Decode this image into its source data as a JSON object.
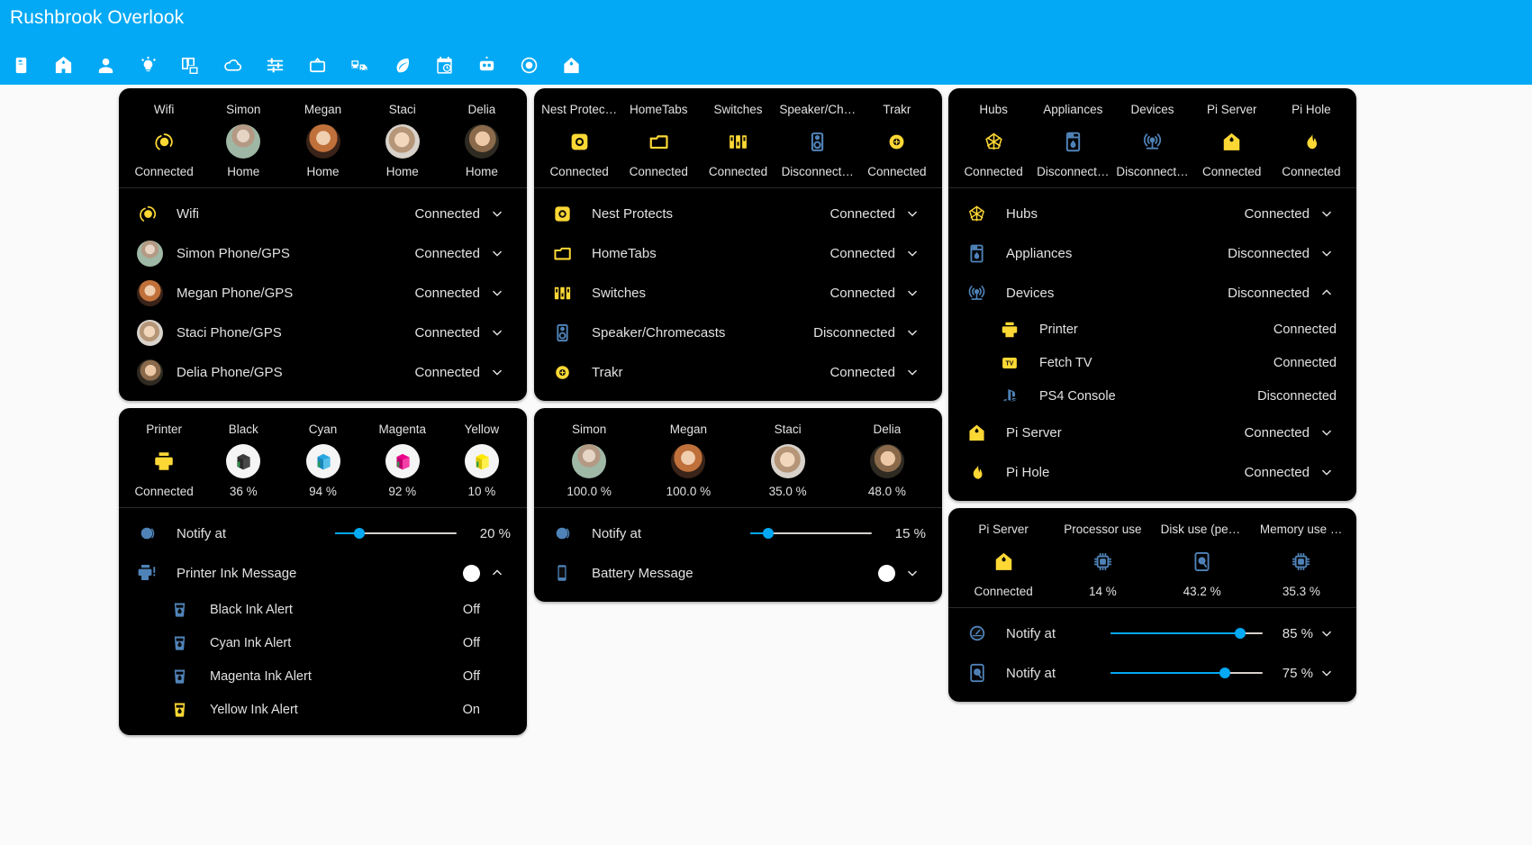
{
  "header": {
    "title": "Rushbrook Overlook",
    "accent": "#03a9f4",
    "tabs": [
      {
        "name": "tab-notebook",
        "icon": "notebook-icon"
      },
      {
        "name": "tab-home-tree",
        "icon": "home-tree-icon"
      },
      {
        "name": "tab-person",
        "icon": "person-icon"
      },
      {
        "name": "tab-lights",
        "icon": "lightbulb-icon"
      },
      {
        "name": "tab-devices",
        "icon": "devices-star-icon",
        "active": true
      },
      {
        "name": "tab-weather",
        "icon": "cloud-icon"
      },
      {
        "name": "tab-settings",
        "icon": "sliders-icon"
      },
      {
        "name": "tab-media",
        "icon": "television-icon"
      },
      {
        "name": "tab-transit",
        "icon": "bus-car-icon"
      },
      {
        "name": "tab-energy",
        "icon": "leaf-icon"
      },
      {
        "name": "tab-calendar",
        "icon": "calendar-clock-icon"
      },
      {
        "name": "tab-automation",
        "icon": "robot-icon"
      },
      {
        "name": "tab-cameras",
        "icon": "eye-icon"
      },
      {
        "name": "tab-house",
        "icon": "home-icon"
      }
    ]
  },
  "cards": {
    "network": {
      "glance": [
        {
          "name": "Wifi",
          "state": "Connected",
          "icon": "wifi-target-icon",
          "color": "#fdd835"
        },
        {
          "name": "Simon",
          "state": "Home",
          "icon": "avatar",
          "avatar": "simon"
        },
        {
          "name": "Megan",
          "state": "Home",
          "icon": "avatar",
          "avatar": "megan"
        },
        {
          "name": "Staci",
          "state": "Home",
          "icon": "avatar",
          "avatar": "staci"
        },
        {
          "name": "Delia",
          "state": "Home",
          "icon": "avatar",
          "avatar": "delia"
        }
      ],
      "rows": [
        {
          "label": "Wifi",
          "state": "Connected",
          "icon": "wifi-target-icon",
          "color": "#fdd835",
          "chevron": "down"
        },
        {
          "label": "Simon Phone/GPS",
          "state": "Connected",
          "icon": "avatar",
          "avatar": "simon",
          "chevron": "down"
        },
        {
          "label": "Megan Phone/GPS",
          "state": "Connected",
          "icon": "avatar",
          "avatar": "megan",
          "chevron": "down"
        },
        {
          "label": "Staci Phone/GPS",
          "state": "Connected",
          "icon": "avatar",
          "avatar": "staci",
          "chevron": "down"
        },
        {
          "label": "Delia Phone/GPS",
          "state": "Connected",
          "icon": "avatar",
          "avatar": "delia",
          "chevron": "down"
        }
      ]
    },
    "printer": {
      "glance": [
        {
          "name": "Printer",
          "state": "Connected",
          "icon": "printer-icon",
          "color": "#fdd835"
        },
        {
          "name": "Black",
          "state": "36 %",
          "icon": "ink-cartridge",
          "inkcolor": "#3c3c3c"
        },
        {
          "name": "Cyan",
          "state": "94 %",
          "icon": "ink-cartridge",
          "inkcolor": "#28a8e0"
        },
        {
          "name": "Magenta",
          "state": "92 %",
          "icon": "ink-cartridge",
          "inkcolor": "#ec008c"
        },
        {
          "name": "Yellow",
          "state": "10 %",
          "icon": "ink-cartridge",
          "inkcolor": "#ffe800"
        }
      ],
      "notify": {
        "label": "Notify at",
        "value": "20 %",
        "percent": 20,
        "icon": "bell-circle-icon"
      },
      "message": {
        "label": "Printer Ink Message",
        "icon": "printer-alert-icon",
        "toggle": "on",
        "chevron": "up"
      },
      "alerts": [
        {
          "label": "Black Ink Alert",
          "state": "Off",
          "icon": "ink-cup-icon",
          "color": "#4f83b8"
        },
        {
          "label": "Cyan Ink Alert",
          "state": "Off",
          "icon": "ink-cup-icon",
          "color": "#4f83b8"
        },
        {
          "label": "Magenta Ink Alert",
          "state": "Off",
          "icon": "ink-cup-icon",
          "color": "#4f83b8"
        },
        {
          "label": "Yellow Ink Alert",
          "state": "On",
          "icon": "ink-cup-icon",
          "color": "#fdd835"
        }
      ]
    },
    "nest": {
      "glance": [
        {
          "name": "Nest Protec…",
          "state": "Connected",
          "icon": "nest-protect-icon",
          "color": "#fdd835"
        },
        {
          "name": "HomeTabs",
          "state": "Connected",
          "icon": "tablet-folder-icon",
          "color": "#fdd835"
        },
        {
          "name": "Switches",
          "state": "Connected",
          "icon": "switches-icon",
          "color": "#fdd835"
        },
        {
          "name": "Speaker/Ch…",
          "state": "Disconnect…",
          "icon": "speaker-icon",
          "color": "#4f83b8"
        },
        {
          "name": "Trakr",
          "state": "Connected",
          "icon": "trakr-icon",
          "color": "#fdd835"
        }
      ],
      "rows": [
        {
          "label": "Nest Protects",
          "state": "Connected",
          "icon": "nest-protect-icon",
          "color": "#fdd835",
          "chevron": "down"
        },
        {
          "label": "HomeTabs",
          "state": "Connected",
          "icon": "tablet-folder-icon",
          "color": "#fdd835",
          "chevron": "down"
        },
        {
          "label": "Switches",
          "state": "Connected",
          "icon": "switches-icon",
          "color": "#fdd835",
          "chevron": "down"
        },
        {
          "label": "Speaker/Chromecasts",
          "state": "Disconnected",
          "icon": "speaker-icon",
          "color": "#4f83b8",
          "chevron": "down"
        },
        {
          "label": "Trakr",
          "state": "Connected",
          "icon": "trakr-icon",
          "color": "#fdd835",
          "chevron": "down"
        }
      ]
    },
    "battery": {
      "glance": [
        {
          "name": "Simon",
          "state": "100.0 %",
          "icon": "avatar",
          "avatar": "simon"
        },
        {
          "name": "Megan",
          "state": "100.0 %",
          "icon": "avatar",
          "avatar": "megan"
        },
        {
          "name": "Staci",
          "state": "35.0 %",
          "icon": "avatar",
          "avatar": "staci"
        },
        {
          "name": "Delia",
          "state": "48.0 %",
          "icon": "avatar",
          "avatar": "delia"
        }
      ],
      "notify": {
        "label": "Notify at",
        "value": "15 %",
        "percent": 15,
        "icon": "bell-circle-icon"
      },
      "message": {
        "label": "Battery Message",
        "icon": "phone-icon",
        "toggle": "on",
        "chevron": "down"
      }
    },
    "hubs": {
      "glance": [
        {
          "name": "Hubs",
          "state": "Connected",
          "icon": "hub-icon",
          "color": "#fdd835"
        },
        {
          "name": "Appliances",
          "state": "Disconnect…",
          "icon": "washer-icon",
          "color": "#4f83b8"
        },
        {
          "name": "Devices",
          "state": "Disconnect…",
          "icon": "broadcast-icon",
          "color": "#4f83b8"
        },
        {
          "name": "Pi Server",
          "state": "Connected",
          "icon": "home-tree-icon",
          "color": "#fdd835"
        },
        {
          "name": "Pi Hole",
          "state": "Connected",
          "icon": "pi-hole-icon",
          "color": "#fdd835"
        }
      ],
      "rows": [
        {
          "label": "Hubs",
          "state": "Connected",
          "icon": "hub-icon",
          "color": "#fdd835",
          "chevron": "down",
          "sub": false
        },
        {
          "label": "Appliances",
          "state": "Disconnected",
          "icon": "washer-icon",
          "color": "#4f83b8",
          "chevron": "down",
          "sub": false
        },
        {
          "label": "Devices",
          "state": "Disconnected",
          "icon": "broadcast-icon",
          "color": "#4f83b8",
          "chevron": "up",
          "sub": false
        },
        {
          "label": "Printer",
          "state": "Connected",
          "icon": "printer-icon",
          "color": "#fdd835",
          "chevron": "none",
          "sub": true
        },
        {
          "label": "Fetch TV",
          "state": "Connected",
          "icon": "fetch-tv-icon",
          "color": "#fdd835",
          "chevron": "none",
          "sub": true
        },
        {
          "label": "PS4 Console",
          "state": "Disconnected",
          "icon": "playstation-icon",
          "color": "#4f83b8",
          "chevron": "none",
          "sub": true
        },
        {
          "label": "Pi Server",
          "state": "Connected",
          "icon": "home-tree-icon",
          "color": "#fdd835",
          "chevron": "down",
          "sub": false
        },
        {
          "label": "Pi Hole",
          "state": "Connected",
          "icon": "pi-hole-icon",
          "color": "#fdd835",
          "chevron": "down",
          "sub": false
        }
      ]
    },
    "piserver": {
      "glance": [
        {
          "name": "Pi Server",
          "state": "Connected",
          "icon": "home-tree-icon",
          "color": "#fdd835"
        },
        {
          "name": "Processor use",
          "state": "14 %",
          "icon": "cpu-icon",
          "color": "#4f83b8"
        },
        {
          "name": "Disk use (perce…",
          "state": "43.2 %",
          "icon": "harddisk-icon",
          "color": "#4f83b8"
        },
        {
          "name": "Memory use (p…",
          "state": "35.3 %",
          "icon": "cpu-icon",
          "color": "#4f83b8"
        }
      ],
      "notify": [
        {
          "label": "Notify at",
          "value": "85 %",
          "percent": 85,
          "icon": "gauge-icon",
          "chevron": "down"
        },
        {
          "label": "Notify at",
          "value": "75 %",
          "percent": 75,
          "icon": "harddisk-circle-icon",
          "chevron": "down"
        }
      ]
    }
  }
}
